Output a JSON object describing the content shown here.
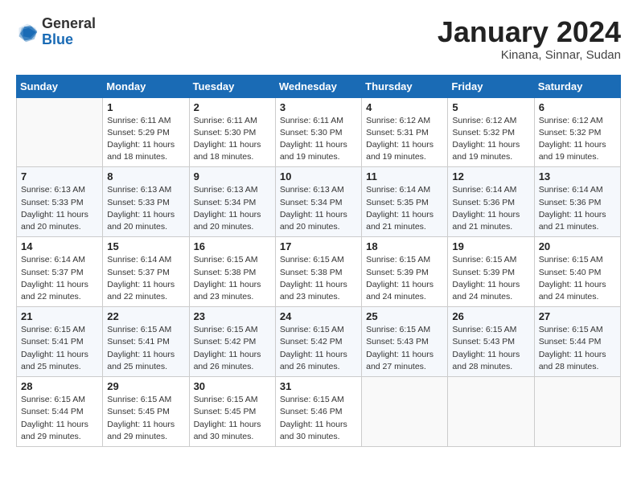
{
  "header": {
    "logo_general": "General",
    "logo_blue": "Blue",
    "month_title": "January 2024",
    "location": "Kinana, Sinnar, Sudan"
  },
  "weekdays": [
    "Sunday",
    "Monday",
    "Tuesday",
    "Wednesday",
    "Thursday",
    "Friday",
    "Saturday"
  ],
  "weeks": [
    [
      {
        "day": "",
        "sunrise": "",
        "sunset": "",
        "daylight": ""
      },
      {
        "day": "1",
        "sunrise": "Sunrise: 6:11 AM",
        "sunset": "Sunset: 5:29 PM",
        "daylight": "Daylight: 11 hours and 18 minutes."
      },
      {
        "day": "2",
        "sunrise": "Sunrise: 6:11 AM",
        "sunset": "Sunset: 5:30 PM",
        "daylight": "Daylight: 11 hours and 18 minutes."
      },
      {
        "day": "3",
        "sunrise": "Sunrise: 6:11 AM",
        "sunset": "Sunset: 5:30 PM",
        "daylight": "Daylight: 11 hours and 19 minutes."
      },
      {
        "day": "4",
        "sunrise": "Sunrise: 6:12 AM",
        "sunset": "Sunset: 5:31 PM",
        "daylight": "Daylight: 11 hours and 19 minutes."
      },
      {
        "day": "5",
        "sunrise": "Sunrise: 6:12 AM",
        "sunset": "Sunset: 5:32 PM",
        "daylight": "Daylight: 11 hours and 19 minutes."
      },
      {
        "day": "6",
        "sunrise": "Sunrise: 6:12 AM",
        "sunset": "Sunset: 5:32 PM",
        "daylight": "Daylight: 11 hours and 19 minutes."
      }
    ],
    [
      {
        "day": "7",
        "sunrise": "Sunrise: 6:13 AM",
        "sunset": "Sunset: 5:33 PM",
        "daylight": "Daylight: 11 hours and 20 minutes."
      },
      {
        "day": "8",
        "sunrise": "Sunrise: 6:13 AM",
        "sunset": "Sunset: 5:33 PM",
        "daylight": "Daylight: 11 hours and 20 minutes."
      },
      {
        "day": "9",
        "sunrise": "Sunrise: 6:13 AM",
        "sunset": "Sunset: 5:34 PM",
        "daylight": "Daylight: 11 hours and 20 minutes."
      },
      {
        "day": "10",
        "sunrise": "Sunrise: 6:13 AM",
        "sunset": "Sunset: 5:34 PM",
        "daylight": "Daylight: 11 hours and 20 minutes."
      },
      {
        "day": "11",
        "sunrise": "Sunrise: 6:14 AM",
        "sunset": "Sunset: 5:35 PM",
        "daylight": "Daylight: 11 hours and 21 minutes."
      },
      {
        "day": "12",
        "sunrise": "Sunrise: 6:14 AM",
        "sunset": "Sunset: 5:36 PM",
        "daylight": "Daylight: 11 hours and 21 minutes."
      },
      {
        "day": "13",
        "sunrise": "Sunrise: 6:14 AM",
        "sunset": "Sunset: 5:36 PM",
        "daylight": "Daylight: 11 hours and 21 minutes."
      }
    ],
    [
      {
        "day": "14",
        "sunrise": "Sunrise: 6:14 AM",
        "sunset": "Sunset: 5:37 PM",
        "daylight": "Daylight: 11 hours and 22 minutes."
      },
      {
        "day": "15",
        "sunrise": "Sunrise: 6:14 AM",
        "sunset": "Sunset: 5:37 PM",
        "daylight": "Daylight: 11 hours and 22 minutes."
      },
      {
        "day": "16",
        "sunrise": "Sunrise: 6:15 AM",
        "sunset": "Sunset: 5:38 PM",
        "daylight": "Daylight: 11 hours and 23 minutes."
      },
      {
        "day": "17",
        "sunrise": "Sunrise: 6:15 AM",
        "sunset": "Sunset: 5:38 PM",
        "daylight": "Daylight: 11 hours and 23 minutes."
      },
      {
        "day": "18",
        "sunrise": "Sunrise: 6:15 AM",
        "sunset": "Sunset: 5:39 PM",
        "daylight": "Daylight: 11 hours and 24 minutes."
      },
      {
        "day": "19",
        "sunrise": "Sunrise: 6:15 AM",
        "sunset": "Sunset: 5:39 PM",
        "daylight": "Daylight: 11 hours and 24 minutes."
      },
      {
        "day": "20",
        "sunrise": "Sunrise: 6:15 AM",
        "sunset": "Sunset: 5:40 PM",
        "daylight": "Daylight: 11 hours and 24 minutes."
      }
    ],
    [
      {
        "day": "21",
        "sunrise": "Sunrise: 6:15 AM",
        "sunset": "Sunset: 5:41 PM",
        "daylight": "Daylight: 11 hours and 25 minutes."
      },
      {
        "day": "22",
        "sunrise": "Sunrise: 6:15 AM",
        "sunset": "Sunset: 5:41 PM",
        "daylight": "Daylight: 11 hours and 25 minutes."
      },
      {
        "day": "23",
        "sunrise": "Sunrise: 6:15 AM",
        "sunset": "Sunset: 5:42 PM",
        "daylight": "Daylight: 11 hours and 26 minutes."
      },
      {
        "day": "24",
        "sunrise": "Sunrise: 6:15 AM",
        "sunset": "Sunset: 5:42 PM",
        "daylight": "Daylight: 11 hours and 26 minutes."
      },
      {
        "day": "25",
        "sunrise": "Sunrise: 6:15 AM",
        "sunset": "Sunset: 5:43 PM",
        "daylight": "Daylight: 11 hours and 27 minutes."
      },
      {
        "day": "26",
        "sunrise": "Sunrise: 6:15 AM",
        "sunset": "Sunset: 5:43 PM",
        "daylight": "Daylight: 11 hours and 28 minutes."
      },
      {
        "day": "27",
        "sunrise": "Sunrise: 6:15 AM",
        "sunset": "Sunset: 5:44 PM",
        "daylight": "Daylight: 11 hours and 28 minutes."
      }
    ],
    [
      {
        "day": "28",
        "sunrise": "Sunrise: 6:15 AM",
        "sunset": "Sunset: 5:44 PM",
        "daylight": "Daylight: 11 hours and 29 minutes."
      },
      {
        "day": "29",
        "sunrise": "Sunrise: 6:15 AM",
        "sunset": "Sunset: 5:45 PM",
        "daylight": "Daylight: 11 hours and 29 minutes."
      },
      {
        "day": "30",
        "sunrise": "Sunrise: 6:15 AM",
        "sunset": "Sunset: 5:45 PM",
        "daylight": "Daylight: 11 hours and 30 minutes."
      },
      {
        "day": "31",
        "sunrise": "Sunrise: 6:15 AM",
        "sunset": "Sunset: 5:46 PM",
        "daylight": "Daylight: 11 hours and 30 minutes."
      },
      {
        "day": "",
        "sunrise": "",
        "sunset": "",
        "daylight": ""
      },
      {
        "day": "",
        "sunrise": "",
        "sunset": "",
        "daylight": ""
      },
      {
        "day": "",
        "sunrise": "",
        "sunset": "",
        "daylight": ""
      }
    ]
  ]
}
